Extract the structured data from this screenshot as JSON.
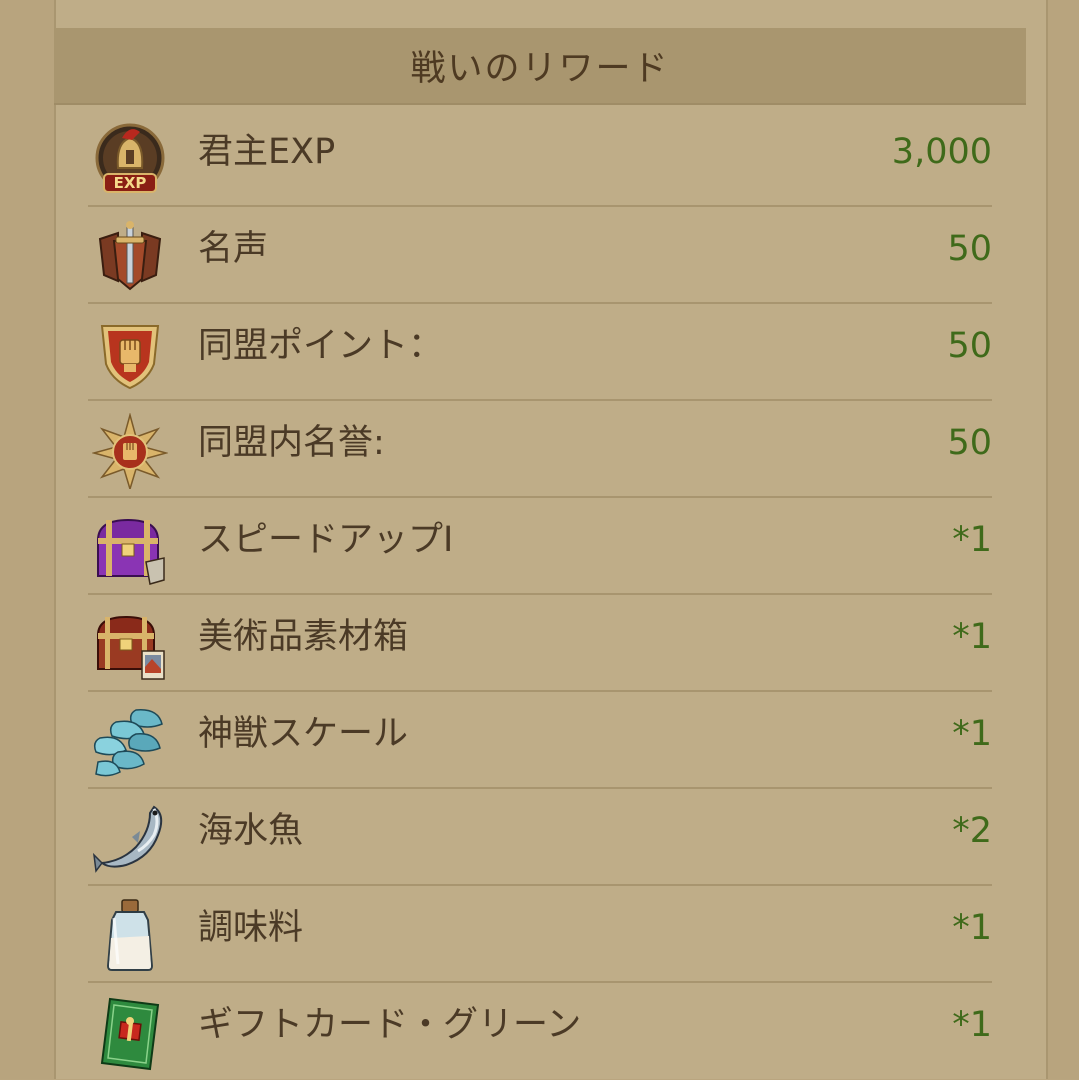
{
  "header": {
    "title": "戦いのリワード"
  },
  "rewards": [
    {
      "label": "君主EXP",
      "value": "3,000",
      "icon": "exp-helmet-icon"
    },
    {
      "label": "名声",
      "value": "50",
      "icon": "sword-shield-icon"
    },
    {
      "label": "同盟ポイント：",
      "value": "50",
      "icon": "fist-shield-icon"
    },
    {
      "label": "同盟内名誉:",
      "value": "50",
      "icon": "fist-star-badge-icon"
    },
    {
      "label": "スピードアップI",
      "value": "*1",
      "icon": "purple-chest-icon"
    },
    {
      "label": "美術品素材箱",
      "value": "*1",
      "icon": "red-chest-icon"
    },
    {
      "label": "神獣スケール",
      "value": "*1",
      "icon": "scales-icon"
    },
    {
      "label": "海水魚",
      "value": "*2",
      "icon": "fish-icon"
    },
    {
      "label": "調味料",
      "value": "*1",
      "icon": "bottle-icon"
    },
    {
      "label": "ギフトカード・グリーン",
      "value": "*1",
      "icon": "gift-card-icon"
    }
  ],
  "colors": {
    "background": "#bfad88",
    "header": "#a9966f",
    "label_text": "#4b3a26",
    "value_text": "#3f6a1a"
  }
}
